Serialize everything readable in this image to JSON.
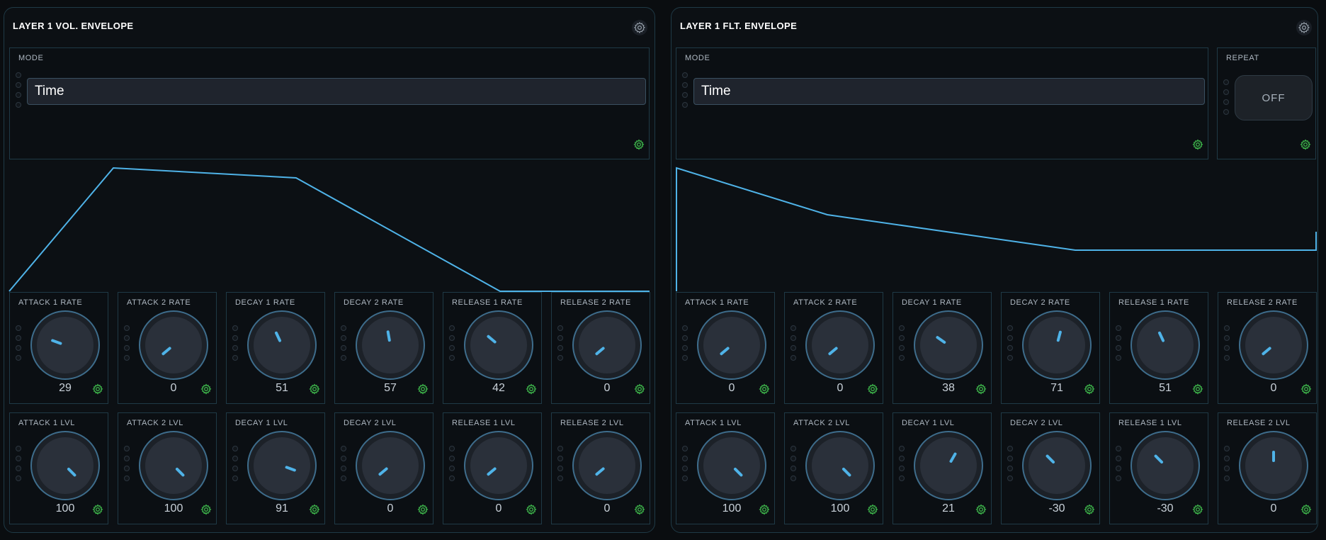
{
  "colors": {
    "accent": "#4fb3e8",
    "gear_green": "#3db34a",
    "border": "#1f3a46"
  },
  "icons": {
    "settings": "gear-icon"
  },
  "panels": [
    {
      "title": "LAYER 1 VOL. ENVELOPE",
      "mode_label": "MODE",
      "mode_value": "Time",
      "rate_knobs": [
        {
          "label": "ATTACK 1 RATE",
          "value": "29",
          "angle": -70
        },
        {
          "label": "ATTACK 2 RATE",
          "value": "0",
          "angle": -130
        },
        {
          "label": "DECAY 1 RATE",
          "value": "51",
          "angle": -25
        },
        {
          "label": "DECAY 2 RATE",
          "value": "57",
          "angle": -10
        },
        {
          "label": "RELEASE 1 RATE",
          "value": "42",
          "angle": -50
        },
        {
          "label": "RELEASE 2 RATE",
          "value": "0",
          "angle": -130
        }
      ],
      "level_knobs": [
        {
          "label": "ATTACK 1 LVL",
          "value": "100",
          "angle": 135
        },
        {
          "label": "ATTACK 2 LVL",
          "value": "100",
          "angle": 135
        },
        {
          "label": "DECAY 1 LVL",
          "value": "91",
          "angle": 110
        },
        {
          "label": "DECAY 2 LVL",
          "value": "0",
          "angle": -130
        },
        {
          "label": "RELEASE 1 LVL",
          "value": "0",
          "angle": -130
        },
        {
          "label": "RELEASE 2 LVL",
          "value": "0",
          "angle": -130
        }
      ]
    },
    {
      "title": "LAYER 1 FLT. ENVELOPE",
      "mode_label": "MODE",
      "mode_value": "Time",
      "repeat_label": "REPEAT",
      "repeat_value": "OFF",
      "rate_knobs": [
        {
          "label": "ATTACK 1 RATE",
          "value": "0",
          "angle": -130
        },
        {
          "label": "ATTACK 2 RATE",
          "value": "0",
          "angle": -130
        },
        {
          "label": "DECAY 1 RATE",
          "value": "38",
          "angle": -55
        },
        {
          "label": "DECAY 2 RATE",
          "value": "71",
          "angle": 15
        },
        {
          "label": "RELEASE 1 RATE",
          "value": "51",
          "angle": -25
        },
        {
          "label": "RELEASE 2 RATE",
          "value": "0",
          "angle": -130
        }
      ],
      "level_knobs": [
        {
          "label": "ATTACK 1 LVL",
          "value": "100",
          "angle": 135
        },
        {
          "label": "ATTACK 2 LVL",
          "value": "100",
          "angle": 135
        },
        {
          "label": "DECAY 1 LVL",
          "value": "21",
          "angle": 30
        },
        {
          "label": "DECAY 2 LVL",
          "value": "-30",
          "angle": -45
        },
        {
          "label": "RELEASE 1 LVL",
          "value": "-30",
          "angle": -45
        },
        {
          "label": "RELEASE 2 LVL",
          "value": "0",
          "angle": 0
        }
      ]
    }
  ]
}
